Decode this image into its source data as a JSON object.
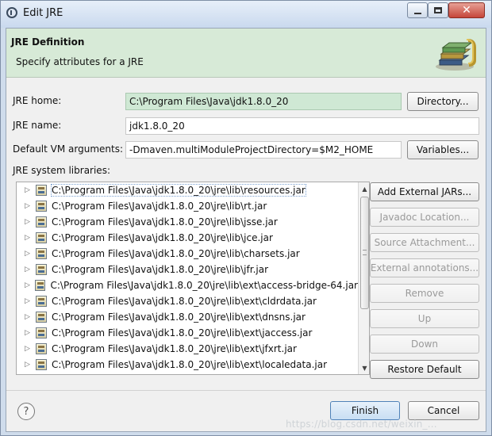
{
  "window": {
    "title": "Edit JRE",
    "minimize_glyph": "",
    "maximize_glyph": "",
    "close_glyph": "✕"
  },
  "header": {
    "title": "JRE Definition",
    "description": "Specify attributes for a JRE",
    "logo_icon": "jre-books-icon"
  },
  "form": {
    "jre_home_label": "JRE home:",
    "jre_home_value": "C:\\Program Files\\Java\\jdk1.8.0_20",
    "directory_button": "Directory...",
    "jre_name_label": "JRE name:",
    "jre_name_value": "jdk1.8.0_20",
    "vm_args_label": "Default VM arguments:",
    "vm_args_value": "-Dmaven.multiModuleProjectDirectory=$M2_HOME",
    "variables_button": "Variables...",
    "libraries_label": "JRE system libraries:"
  },
  "libraries": {
    "items": [
      "C:\\Program Files\\Java\\jdk1.8.0_20\\jre\\lib\\resources.jar",
      "C:\\Program Files\\Java\\jdk1.8.0_20\\jre\\lib\\rt.jar",
      "C:\\Program Files\\Java\\jdk1.8.0_20\\jre\\lib\\jsse.jar",
      "C:\\Program Files\\Java\\jdk1.8.0_20\\jre\\lib\\jce.jar",
      "C:\\Program Files\\Java\\jdk1.8.0_20\\jre\\lib\\charsets.jar",
      "C:\\Program Files\\Java\\jdk1.8.0_20\\jre\\lib\\jfr.jar",
      "C:\\Program Files\\Java\\jdk1.8.0_20\\jre\\lib\\ext\\access-bridge-64.jar",
      "C:\\Program Files\\Java\\jdk1.8.0_20\\jre\\lib\\ext\\cldrdata.jar",
      "C:\\Program Files\\Java\\jdk1.8.0_20\\jre\\lib\\ext\\dnsns.jar",
      "C:\\Program Files\\Java\\jdk1.8.0_20\\jre\\lib\\ext\\jaccess.jar",
      "C:\\Program Files\\Java\\jdk1.8.0_20\\jre\\lib\\ext\\jfxrt.jar",
      "C:\\Program Files\\Java\\jdk1.8.0_20\\jre\\lib\\ext\\localedata.jar"
    ]
  },
  "buttons": {
    "add_external_jars": "Add External JARs...",
    "javadoc_location": "Javadoc Location...",
    "source_attachment": "Source Attachment...",
    "external_annotations": "External annotations...",
    "remove": "Remove",
    "up": "Up",
    "down": "Down",
    "restore_default": "Restore Default",
    "finish": "Finish",
    "cancel": "Cancel",
    "help": "?"
  },
  "watermark": {
    "text": "https://blog.csdn.net/weixin_..."
  },
  "colors": {
    "header_bg": "#d7ead7",
    "selected_field_bg": "#cfe8d4",
    "window_frame": "#cfdcec"
  }
}
